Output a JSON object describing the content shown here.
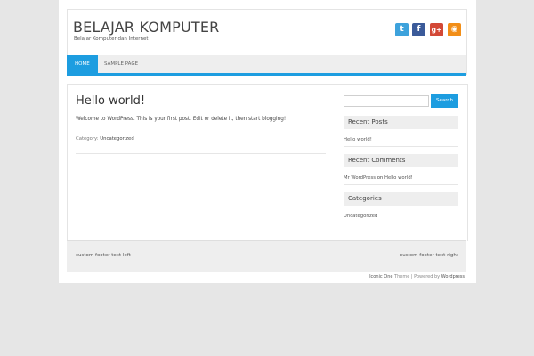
{
  "site": {
    "title": "BELAJAR KOMPUTER",
    "description": "Belajar Komputer dan Internet"
  },
  "social": [
    {
      "name": "twitter-icon",
      "glyph": "t",
      "color": "#3da2dc"
    },
    {
      "name": "facebook-icon",
      "glyph": "f",
      "color": "#3b5a99"
    },
    {
      "name": "google-plus-icon",
      "glyph": "g+",
      "color": "#d34836"
    },
    {
      "name": "rss-icon",
      "glyph": "◉",
      "color": "#f28e17"
    }
  ],
  "nav": {
    "items": [
      {
        "label": "HOME",
        "active": true
      },
      {
        "label": "SAMPLE PAGE",
        "active": false
      }
    ]
  },
  "post": {
    "title": "Hello world!",
    "body": "Welcome to WordPress. This is your first post. Edit or delete it, then start blogging!",
    "category_label": "Category:",
    "category": "Uncategorized"
  },
  "sidebar": {
    "search": {
      "placeholder": "",
      "button": "Search"
    },
    "recent_posts": {
      "title": "Recent Posts",
      "items": [
        "Hello world!"
      ]
    },
    "recent_comments": {
      "title": "Recent Comments",
      "author": "Mr WordPress",
      "connector": "on",
      "post": "Hello world!"
    },
    "categories": {
      "title": "Categories",
      "items": [
        "Uncategorized"
      ]
    }
  },
  "footer": {
    "left": "custom footer text left",
    "right": "custom footer text right",
    "credits": {
      "theme": "Iconic One",
      "theme_suffix": "Theme | Powered by",
      "platform": "Wordpress"
    }
  },
  "colors": {
    "accent": "#1d9de0"
  }
}
